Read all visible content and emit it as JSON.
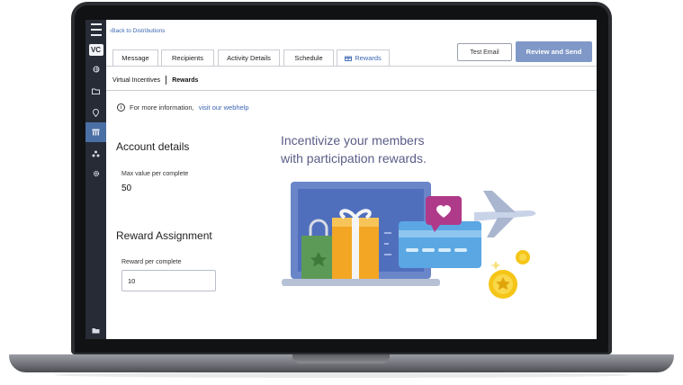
{
  "nav": {
    "back_link": "Back to Distributions",
    "vc_badge": "VC",
    "items": [
      "menu-icon",
      "globe-icon",
      "folder-icon",
      "location-icon",
      "building-icon",
      "share-icon",
      "gear-icon",
      "folder-bottom-icon"
    ]
  },
  "tabs": [
    {
      "label": "Message"
    },
    {
      "label": "Recipients"
    },
    {
      "label": "Activity Details"
    },
    {
      "label": "Schedule"
    },
    {
      "label": "Rewards",
      "icon": "gift-icon",
      "active": true
    }
  ],
  "actions": {
    "test_email": "Test Email",
    "review_send": "Review and Send"
  },
  "subtabs": {
    "first": "Virtual Incentives",
    "second": "Rewards"
  },
  "info": {
    "text": "For more information,",
    "link": "visit our webhelp"
  },
  "account": {
    "heading": "Account details",
    "max_label": "Max value per complete",
    "max_value": "50"
  },
  "reward": {
    "heading": "Reward Assignment",
    "label": "Reward per complete",
    "value": "10"
  },
  "promo": {
    "line1": "Incentivize your members",
    "line2": "with participation rewards."
  },
  "colors": {
    "accent": "#3b66b3",
    "primary_button": "#7f98c7",
    "sidebar": "#262b36",
    "tagline": "#5a5c87"
  }
}
